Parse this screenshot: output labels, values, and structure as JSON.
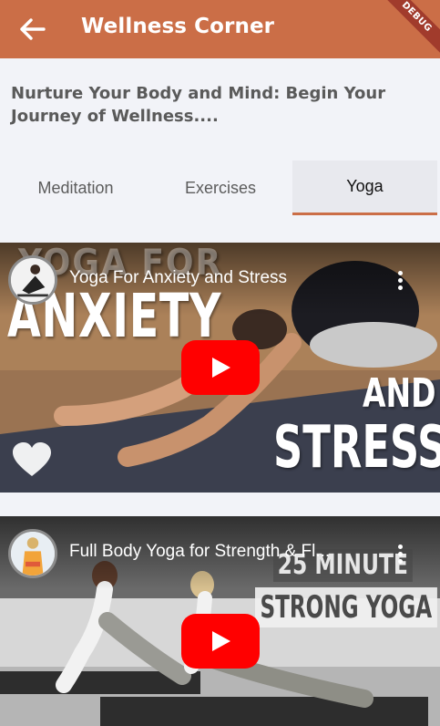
{
  "appbar": {
    "title": "Wellness Corner",
    "back_icon": "arrow-left-icon",
    "debug_label": "DEBUG"
  },
  "intro": {
    "text": "Nurture Your Body and Mind: Begin Your Journey of Wellness...."
  },
  "tabs": [
    {
      "label": "Meditation",
      "selected": false
    },
    {
      "label": "Exercises",
      "selected": false
    },
    {
      "label": "Yoga",
      "selected": true
    }
  ],
  "videos": [
    {
      "title": "Yoga For Anxiety and Stress",
      "thumbnail_text": {
        "line1": "YOGA FOR",
        "line2": "ANXIETY",
        "line3": "AND",
        "line4": "STRESS"
      }
    },
    {
      "title": "Full Body Yoga for Strength & Fl...",
      "thumbnail_text": {
        "line1": "25 MINUTE",
        "line2": "STRONG YOGA"
      }
    }
  ],
  "colors": {
    "appbar": "#cb6e47",
    "tab_indicator": "#cb6e47",
    "play_button": "#ff0000",
    "background": "#f2f3f8"
  }
}
